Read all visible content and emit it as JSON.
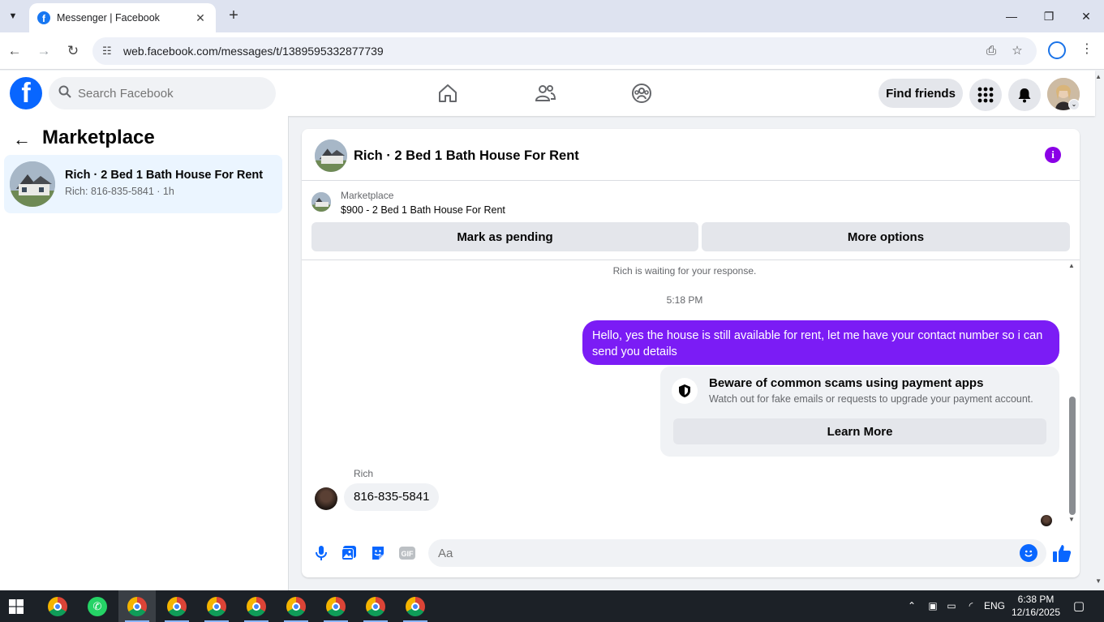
{
  "browser": {
    "tab_title": "Messenger | Facebook",
    "url": "web.facebook.com/messages/t/1389595332877739"
  },
  "fb": {
    "search_placeholder": "Search Facebook",
    "find_friends": "Find friends"
  },
  "left": {
    "title": "Marketplace",
    "thread": {
      "name": "Rich · 2 Bed 1 Bath House For Rent",
      "subtitle": "Rich: 816-835-5841 · 1h"
    }
  },
  "conversation": {
    "title": "Rich · 2 Bed 1 Bath House For Rent",
    "marketplace_label": "Marketplace",
    "listing": "$900 - 2 Bed 1 Bath House For Rent",
    "mark_pending": "Mark as pending",
    "more_options": "More options",
    "waiting_text": "Rich is waiting for your response.",
    "timestamp": "5:18 PM",
    "outgoing_message": "Hello, yes the house is still available for rent, let me have your contact number so i can send you  details",
    "scam_title": "Beware of common scams using payment apps",
    "scam_text": "Watch out for fake emails or requests to upgrade your payment account.",
    "learn_more": "Learn More",
    "sender_name": "Rich",
    "incoming_message": "816-835-5841",
    "composer_placeholder": "Aa"
  },
  "taskbar": {
    "language": "ENG",
    "time": "6:38 PM",
    "date": "12/16/2025"
  },
  "colors": {
    "fb_blue": "#0866ff",
    "messenger_purple": "#7b1cf5",
    "selected_thread": "#ebf5ff"
  }
}
